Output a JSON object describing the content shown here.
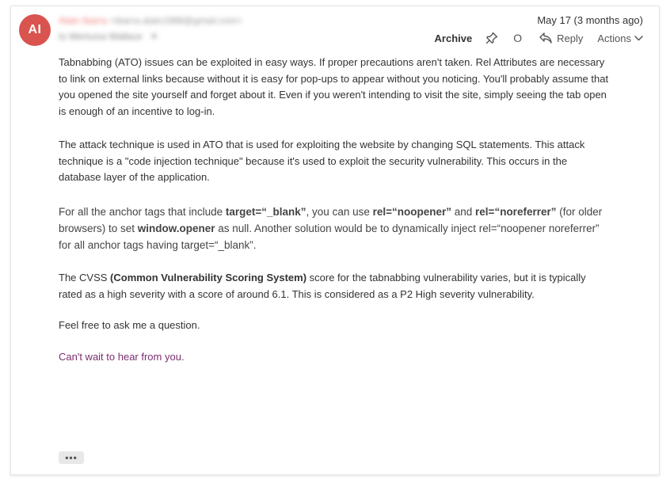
{
  "sender": {
    "initials": "AI",
    "name": "Alain Ibarra",
    "email": "<ibarra.alain1988@gmail.com>",
    "recipient": "to Memuna Wallace",
    "recipient_extra": "✕"
  },
  "header": {
    "date": "May 17 (3 months ago)"
  },
  "toolbar": {
    "archive_label": "Archive",
    "status_glyph": "O",
    "reply_label": "Reply",
    "actions_label": "Actions"
  },
  "body": {
    "p1": "Tabnabbing (ATO) issues can be exploited in easy ways. If proper precautions aren't taken. Rel Attributes are necessary to link on external links because without it is easy for pop-ups to appear without you noticing. You'll probably assume that you opened the site yourself and forget about it. Even if you weren't intending to visit the site, simply seeing the tab open is enough of an incentive to log-in.",
    "p2": "The attack technique is used in ATO that is used for exploiting the website by changing SQL statements. This attack technique is a \"code injection technique\" because it's used to exploit the security vulnerability. This occurs in the database layer of the application.",
    "p3": {
      "t1": "For all the anchor tags that include ",
      "b1": "target=“_blank”",
      "t2": ", you can use ",
      "b2": "rel=“noopener”",
      "t3": " and ",
      "b3": "rel=“noreferrer”",
      "t4": " (for older browsers) to set ",
      "b4": "window.opener",
      "t5": " as null. Another solution would be to dynamically inject rel=“noopener noreferrer” for all anchor tags having target=“_blank”."
    },
    "p4": {
      "t1": "The CVSS ",
      "b1": "(Common Vulnerability Scoring System)",
      "t2": " score for the tabnabbing vulnerability varies, but it is typically rated as a high severity with a score of around 6.1. This is considered as a P2 High severity vulnerability."
    },
    "p5": "Feel free to ask me a question.",
    "p6": "Can't wait to hear from you."
  },
  "footer": {
    "ellipsis": "•••"
  }
}
